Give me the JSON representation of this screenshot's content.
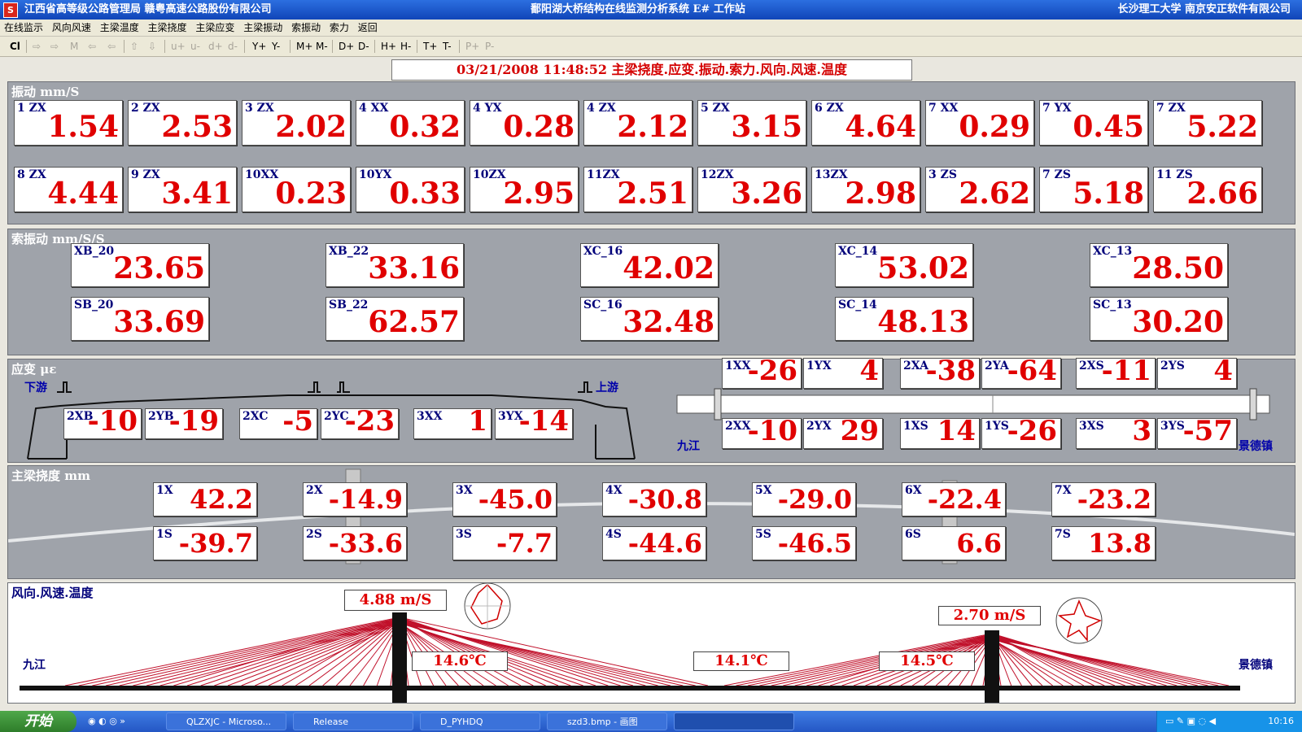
{
  "window": {
    "icon": "S",
    "title_left": "江西省高等级公路管理局  赣粤高速公路股份有限公司",
    "title_center": "鄱阳湖大桥结构在线监测分析系统 E# 工作站",
    "title_right": "长沙理工大学  南京安正软件有限公司"
  },
  "menu": [
    "在线监示",
    "风向风速",
    "主梁温度",
    "主梁挠度",
    "主梁应变",
    "主梁振动",
    "索振动",
    "索力",
    "返回"
  ],
  "toolbar": [
    "Cl",
    "⇨",
    "⇨",
    "M",
    "⇦",
    "⇦",
    "⇧",
    "⇩",
    "u+",
    "u-",
    "d+",
    "d-",
    "Y+",
    "Y-",
    "M+",
    "M-",
    "D+",
    "D-",
    "H+",
    "H-",
    "T+",
    "T-",
    "P+",
    "P-"
  ],
  "headline": "03/21/2008  11:48:52  主梁挠度.应变.振动.索力.风向.风速.温度",
  "vibration": {
    "title": "振动 mm/S",
    "row1": [
      [
        "1 ZX",
        "1.54"
      ],
      [
        "2 ZX",
        "2.53"
      ],
      [
        "3 ZX",
        "2.02"
      ],
      [
        "4 XX",
        "0.32"
      ],
      [
        "4 YX",
        "0.28"
      ],
      [
        "4 ZX",
        "2.12"
      ],
      [
        "5 ZX",
        "3.15"
      ],
      [
        "6 ZX",
        "4.64"
      ],
      [
        "7 XX",
        "0.29"
      ],
      [
        "7 YX",
        "0.45"
      ],
      [
        "7 ZX",
        "5.22"
      ]
    ],
    "row2": [
      [
        "8 ZX",
        "4.44"
      ],
      [
        "9 ZX",
        "3.41"
      ],
      [
        "10XX",
        "0.23"
      ],
      [
        "10YX",
        "0.33"
      ],
      [
        "10ZX",
        "2.95"
      ],
      [
        "11ZX",
        "2.51"
      ],
      [
        "12ZX",
        "3.26"
      ],
      [
        "13ZX",
        "2.98"
      ],
      [
        "3 ZS",
        "2.62"
      ],
      [
        "7 ZS",
        "5.18"
      ],
      [
        "11 ZS",
        "2.66"
      ]
    ]
  },
  "cable": {
    "title": "索振动 mm/S/S",
    "row1": [
      [
        "XB_20",
        "23.65"
      ],
      [
        "XB_22",
        "33.16"
      ],
      [
        "XC_16",
        "42.02"
      ],
      [
        "XC_14",
        "53.02"
      ],
      [
        "XC_13",
        "28.50"
      ]
    ],
    "row2": [
      [
        "SB_20",
        "33.69"
      ],
      [
        "SB_22",
        "62.57"
      ],
      [
        "SC_16",
        "32.48"
      ],
      [
        "SC_14",
        "48.13"
      ],
      [
        "SC_13",
        "30.20"
      ]
    ]
  },
  "strain": {
    "title": "应变 με",
    "downstream": "下游",
    "upstream": "上游",
    "left_boxes": [
      [
        "2XB",
        "-10"
      ],
      [
        "2YB",
        "-19"
      ],
      [
        "2XC",
        "-5"
      ],
      [
        "2YC",
        "-23"
      ],
      [
        "3XX",
        "1"
      ],
      [
        "3YX",
        "-14"
      ]
    ],
    "top_boxes": [
      [
        "1XX",
        "-26"
      ],
      [
        "1YX",
        "4"
      ],
      [
        "2XA",
        "-38"
      ],
      [
        "2YA",
        "-64"
      ],
      [
        "2XS",
        "-11"
      ],
      [
        "2YS",
        "4"
      ]
    ],
    "bottom_boxes": [
      [
        "2XX",
        "-10"
      ],
      [
        "2YX",
        "29"
      ],
      [
        "1XS",
        "14"
      ],
      [
        "1YS",
        "-26"
      ],
      [
        "3XS",
        "3"
      ],
      [
        "3YS",
        "-57"
      ]
    ],
    "jiujiang": "九江",
    "jingdezhen": "景德镇"
  },
  "deflection": {
    "title": "主梁挠度 mm",
    "row1": [
      [
        "1X",
        "42.2"
      ],
      [
        "2X",
        "-14.9"
      ],
      [
        "3X",
        "-45.0"
      ],
      [
        "4X",
        "-30.8"
      ],
      [
        "5X",
        "-29.0"
      ],
      [
        "6X",
        "-22.4"
      ],
      [
        "7X",
        "-23.2"
      ]
    ],
    "row2": [
      [
        "1S",
        "-39.7"
      ],
      [
        "2S",
        "-33.6"
      ],
      [
        "3S",
        "-7.7"
      ],
      [
        "4S",
        "-44.6"
      ],
      [
        "5S",
        "-46.5"
      ],
      [
        "6S",
        "6.6"
      ],
      [
        "7S",
        "13.8"
      ]
    ]
  },
  "wind": {
    "title": "风向.风速.温度",
    "speed_left": "4.88 m/S",
    "speed_right": "2.70 m/S",
    "temps": [
      "14.6℃",
      "14.1℃",
      "14.5℃"
    ],
    "jiujiang": "九江",
    "jingdezhen": "景德镇"
  },
  "taskbar": {
    "start": "开始",
    "tasks": [
      "QLZXJC - Microso...",
      "Release",
      "D_PYHDQ",
      "szd3.bmp - 画图",
      ""
    ],
    "clock": "10:16"
  },
  "colors": {
    "value_red": "#e00000",
    "label_navy": "#00007a",
    "panel_gray": "#9fa3aa",
    "cable_red": "#c0102a"
  }
}
